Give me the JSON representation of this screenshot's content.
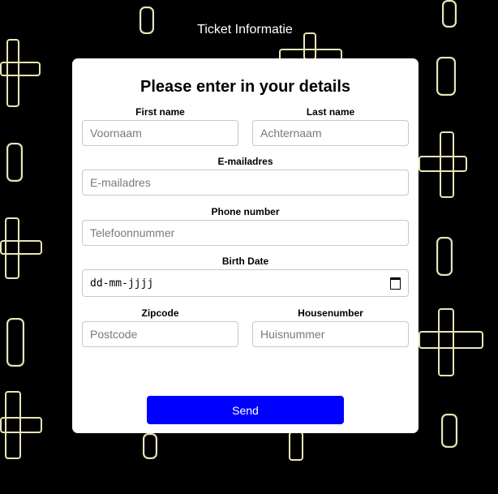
{
  "header": {
    "title": "Ticket Informatie"
  },
  "form": {
    "title": "Please enter in your details",
    "first_name": {
      "label": "First name",
      "placeholder": "Voornaam"
    },
    "last_name": {
      "label": "Last name",
      "placeholder": "Achternaam"
    },
    "email": {
      "label": "E-mailadres",
      "placeholder": "E-mailadres"
    },
    "phone": {
      "label": "Phone number",
      "placeholder": "Telefoonnummer"
    },
    "birth_date": {
      "label": "Birth Date",
      "value_display": "dd-mm-jjjj",
      "icon": "calendar-icon"
    },
    "zipcode": {
      "label": "Zipcode",
      "placeholder": "Postcode"
    },
    "housenumber": {
      "label": "Housenumber",
      "placeholder": "Huisnummer"
    },
    "submit_label": "Send"
  },
  "colors": {
    "page_background": "#000000",
    "card_background": "#ffffff",
    "button_background": "#0000ff",
    "button_text": "#ffffff",
    "pattern_outline": "#e8e6b8"
  }
}
